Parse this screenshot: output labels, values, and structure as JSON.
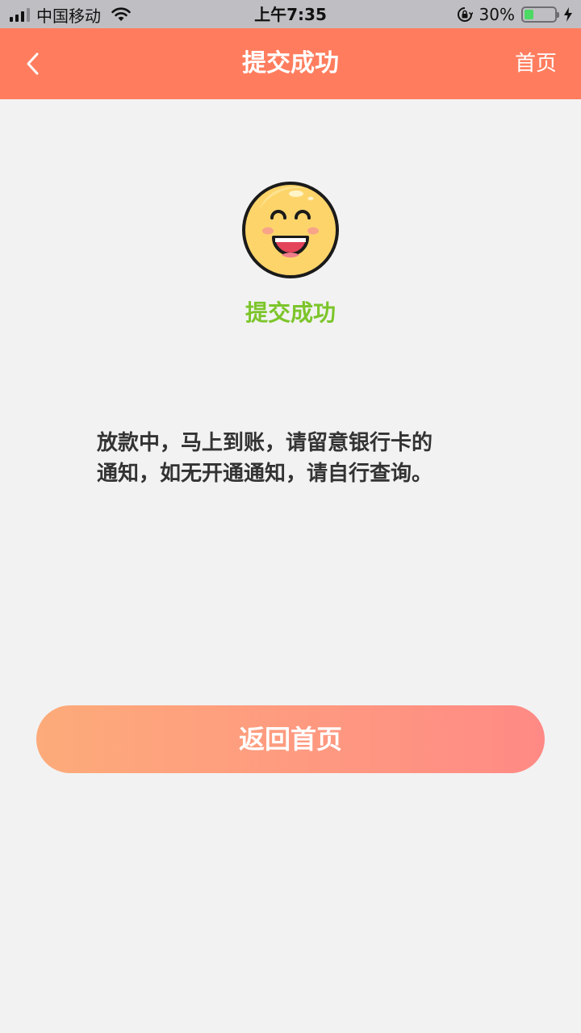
{
  "status_bar": {
    "carrier": "中国移动",
    "time": "上午7:35",
    "battery_percent": "30%",
    "battery_level": 0.3,
    "icons": [
      "signal-icon",
      "wifi-icon",
      "orientation-lock-icon",
      "battery-icon",
      "charging-icon"
    ]
  },
  "nav": {
    "back_icon": "chevron-left-icon",
    "title": "提交成功",
    "home_label": "首页"
  },
  "result": {
    "icon": "smiley-face-icon",
    "label": "提交成功",
    "label_color": "#7cc52a",
    "message_lines": [
      "放款中，马上到账，请留意银行卡的",
      "通知，如无开通通知，请自行查询。"
    ]
  },
  "actions": {
    "return_home_label": "返回首页"
  },
  "colors": {
    "nav_background": "#ff7d5e",
    "button_gradient_start": "#fdab7a",
    "button_gradient_end": "#ff8a85",
    "page_background": "#f2f2f2"
  }
}
